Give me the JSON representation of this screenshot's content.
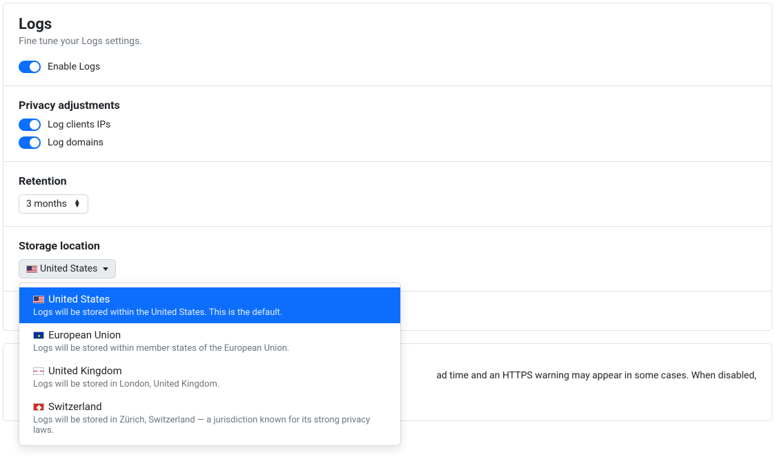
{
  "logs": {
    "title": "Logs",
    "subtitle": "Fine tune your Logs settings.",
    "enable_label": "Enable Logs"
  },
  "privacy": {
    "title": "Privacy adjustments",
    "ips_label": "Log clients IPs",
    "domains_label": "Log domains"
  },
  "retention": {
    "title": "Retention",
    "value": "3 months"
  },
  "storage": {
    "title": "Storage location",
    "selected": "United States",
    "options": [
      {
        "flag": "us",
        "name": "United States",
        "desc": "Logs will be stored within the United States. This is the default.",
        "active": true
      },
      {
        "flag": "eu",
        "name": "European Union",
        "desc": "Logs will be stored within member states of the European Union."
      },
      {
        "flag": "uk",
        "name": "United Kingdom",
        "desc": "Logs will be stored in London, United Kingdom."
      },
      {
        "flag": "ch",
        "name": "Switzerland",
        "desc": "Logs will be stored in Zürich, Switzerland — a jurisdiction known for its strong privacy laws."
      }
    ]
  },
  "blockpage": {
    "fragment": "ad time and an HTTPS warning may appear in some cases. When disabled,"
  }
}
